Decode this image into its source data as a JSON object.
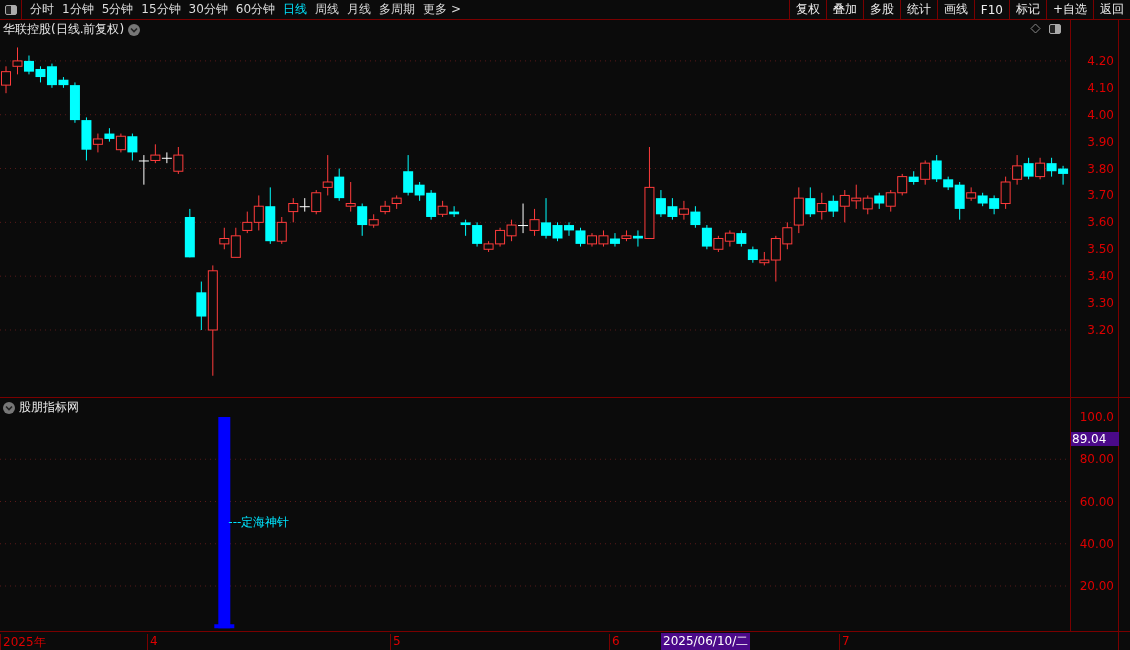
{
  "toolbar": {
    "periods": [
      {
        "label": "分时",
        "selected": false
      },
      {
        "label": "1分钟",
        "selected": false
      },
      {
        "label": "5分钟",
        "selected": false
      },
      {
        "label": "15分钟",
        "selected": false
      },
      {
        "label": "30分钟",
        "selected": false
      },
      {
        "label": "60分钟",
        "selected": false
      },
      {
        "label": "日线",
        "selected": true
      },
      {
        "label": "周线",
        "selected": false
      },
      {
        "label": "月线",
        "selected": false
      },
      {
        "label": "多周期",
        "selected": false
      },
      {
        "label": "更多 >",
        "selected": false
      }
    ],
    "buttons": [
      "复权",
      "叠加",
      "多股",
      "统计",
      "画线",
      "F10",
      "标记",
      "+自选",
      "返回"
    ]
  },
  "price_panel": {
    "title": "华联控股(日线.前复权)",
    "chart_data": {
      "type": "candlestick",
      "grid": true,
      "ylim": [
        2.951,
        4.352
      ],
      "yticks": [
        {
          "value": 4.2,
          "label": "4.20"
        },
        {
          "value": 4.1,
          "label": "4.10"
        },
        {
          "value": 4.0,
          "label": "4.00"
        },
        {
          "value": 3.9,
          "label": "3.90"
        },
        {
          "value": 3.8,
          "label": "3.80"
        },
        {
          "value": 3.7,
          "label": "3.70"
        },
        {
          "value": 3.6,
          "label": "3.60"
        },
        {
          "value": 3.5,
          "label": "3.50"
        },
        {
          "value": 3.4,
          "label": "3.40"
        },
        {
          "value": 3.3,
          "label": "3.30"
        },
        {
          "value": 3.2,
          "label": "3.20"
        }
      ],
      "ohlc": [
        [
          4.11,
          4.18,
          4.08,
          4.16
        ],
        [
          4.18,
          4.25,
          4.15,
          4.2
        ],
        [
          4.2,
          4.22,
          4.15,
          4.16
        ],
        [
          4.17,
          4.18,
          4.12,
          4.14
        ],
        [
          4.18,
          4.19,
          4.1,
          4.11
        ],
        [
          4.13,
          4.14,
          4.1,
          4.11
        ],
        [
          4.11,
          4.12,
          3.97,
          3.98
        ],
        [
          3.98,
          3.99,
          3.83,
          3.87
        ],
        [
          3.89,
          3.93,
          3.86,
          3.91
        ],
        [
          3.93,
          3.95,
          3.9,
          3.91
        ],
        [
          3.87,
          3.93,
          3.86,
          3.92
        ],
        [
          3.92,
          3.93,
          3.83,
          3.86
        ],
        [
          3.83,
          3.85,
          3.74,
          3.83
        ],
        [
          3.83,
          3.89,
          3.82,
          3.85
        ],
        [
          3.84,
          3.86,
          3.82,
          3.84
        ],
        [
          3.79,
          3.88,
          3.78,
          3.85
        ],
        [
          3.62,
          3.65,
          3.47,
          3.47
        ],
        [
          3.34,
          3.38,
          3.2,
          3.25
        ],
        [
          3.2,
          3.44,
          3.03,
          3.42
        ],
        [
          3.52,
          3.58,
          3.5,
          3.54
        ],
        [
          3.47,
          3.58,
          3.47,
          3.55
        ],
        [
          3.57,
          3.64,
          3.56,
          3.6
        ],
        [
          3.6,
          3.7,
          3.57,
          3.66
        ],
        [
          3.66,
          3.73,
          3.52,
          3.53
        ],
        [
          3.53,
          3.62,
          3.52,
          3.6
        ],
        [
          3.64,
          3.69,
          3.6,
          3.67
        ],
        [
          3.66,
          3.69,
          3.64,
          3.66
        ],
        [
          3.64,
          3.72,
          3.63,
          3.71
        ],
        [
          3.73,
          3.85,
          3.7,
          3.75
        ],
        [
          3.77,
          3.8,
          3.68,
          3.69
        ],
        [
          3.66,
          3.75,
          3.64,
          3.67
        ],
        [
          3.66,
          3.67,
          3.55,
          3.59
        ],
        [
          3.59,
          3.63,
          3.58,
          3.61
        ],
        [
          3.64,
          3.68,
          3.63,
          3.66
        ],
        [
          3.67,
          3.7,
          3.65,
          3.69
        ],
        [
          3.79,
          3.85,
          3.7,
          3.71
        ],
        [
          3.74,
          3.75,
          3.68,
          3.7
        ],
        [
          3.71,
          3.72,
          3.61,
          3.62
        ],
        [
          3.63,
          3.68,
          3.62,
          3.66
        ],
        [
          3.64,
          3.66,
          3.62,
          3.63
        ],
        [
          3.6,
          3.61,
          3.55,
          3.59
        ],
        [
          3.59,
          3.6,
          3.51,
          3.52
        ],
        [
          3.5,
          3.53,
          3.49,
          3.52
        ],
        [
          3.52,
          3.58,
          3.51,
          3.57
        ],
        [
          3.55,
          3.61,
          3.53,
          3.59
        ],
        [
          3.59,
          3.67,
          3.56,
          3.59
        ],
        [
          3.57,
          3.65,
          3.55,
          3.61
        ],
        [
          3.6,
          3.69,
          3.54,
          3.55
        ],
        [
          3.59,
          3.6,
          3.53,
          3.54
        ],
        [
          3.59,
          3.6,
          3.55,
          3.57
        ],
        [
          3.57,
          3.58,
          3.51,
          3.52
        ],
        [
          3.52,
          3.56,
          3.51,
          3.55
        ],
        [
          3.52,
          3.57,
          3.51,
          3.55
        ],
        [
          3.54,
          3.56,
          3.51,
          3.52
        ],
        [
          3.54,
          3.57,
          3.53,
          3.55
        ],
        [
          3.55,
          3.57,
          3.51,
          3.54
        ],
        [
          3.54,
          3.88,
          3.54,
          3.73
        ],
        [
          3.69,
          3.72,
          3.62,
          3.63
        ],
        [
          3.66,
          3.69,
          3.61,
          3.62
        ],
        [
          3.63,
          3.68,
          3.61,
          3.65
        ],
        [
          3.64,
          3.66,
          3.58,
          3.59
        ],
        [
          3.58,
          3.59,
          3.5,
          3.51
        ],
        [
          3.5,
          3.55,
          3.49,
          3.54
        ],
        [
          3.53,
          3.57,
          3.51,
          3.56
        ],
        [
          3.56,
          3.57,
          3.51,
          3.52
        ],
        [
          3.5,
          3.51,
          3.45,
          3.46
        ],
        [
          3.45,
          3.49,
          3.44,
          3.46
        ],
        [
          3.46,
          3.55,
          3.38,
          3.54
        ],
        [
          3.52,
          3.6,
          3.5,
          3.58
        ],
        [
          3.59,
          3.73,
          3.56,
          3.69
        ],
        [
          3.69,
          3.73,
          3.62,
          3.63
        ],
        [
          3.64,
          3.71,
          3.61,
          3.67
        ],
        [
          3.68,
          3.7,
          3.62,
          3.64
        ],
        [
          3.66,
          3.72,
          3.6,
          3.7
        ],
        [
          3.68,
          3.74,
          3.65,
          3.69
        ],
        [
          3.65,
          3.7,
          3.63,
          3.69
        ],
        [
          3.7,
          3.71,
          3.65,
          3.67
        ],
        [
          3.66,
          3.72,
          3.64,
          3.71
        ],
        [
          3.71,
          3.78,
          3.7,
          3.77
        ],
        [
          3.77,
          3.79,
          3.74,
          3.75
        ],
        [
          3.76,
          3.83,
          3.74,
          3.82
        ],
        [
          3.83,
          3.85,
          3.75,
          3.76
        ],
        [
          3.76,
          3.77,
          3.72,
          3.73
        ],
        [
          3.74,
          3.75,
          3.61,
          3.65
        ],
        [
          3.69,
          3.73,
          3.68,
          3.71
        ],
        [
          3.7,
          3.71,
          3.66,
          3.67
        ],
        [
          3.69,
          3.7,
          3.63,
          3.65
        ],
        [
          3.67,
          3.77,
          3.65,
          3.75
        ],
        [
          3.76,
          3.85,
          3.74,
          3.81
        ],
        [
          3.82,
          3.84,
          3.76,
          3.77
        ],
        [
          3.77,
          3.84,
          3.76,
          3.82
        ],
        [
          3.82,
          3.84,
          3.77,
          3.79
        ],
        [
          3.8,
          3.81,
          3.74,
          3.78
        ]
      ]
    }
  },
  "indicator_panel": {
    "title": "股朋指标网",
    "chart_data": {
      "type": "bar",
      "grid": true,
      "ylim": [
        -1.3,
        109
      ],
      "yticks": [
        {
          "value": 100,
          "label": "100.0"
        },
        {
          "value": 80,
          "label": "80.00"
        },
        {
          "value": 60,
          "label": "60.00"
        },
        {
          "value": 40,
          "label": "40.00"
        },
        {
          "value": 20,
          "label": "20.00"
        }
      ],
      "series": [
        {
          "color": "#0000ff",
          "values": [
            null,
            null,
            null,
            null,
            null,
            null,
            null,
            null,
            null,
            null,
            null,
            null,
            null,
            null,
            null,
            null,
            null,
            null,
            null,
            100,
            null,
            null,
            null,
            null,
            null,
            null,
            null,
            null,
            null,
            null,
            null,
            null,
            null,
            null,
            null,
            null,
            null,
            null,
            null,
            null,
            null,
            null,
            null,
            null,
            null,
            null,
            null,
            null,
            null,
            null,
            null,
            null,
            null,
            null,
            null,
            null,
            null,
            null,
            null,
            null,
            null,
            null,
            null,
            null,
            null,
            null,
            null,
            null,
            null,
            null,
            null,
            null,
            null,
            null,
            null,
            null,
            null,
            null,
            null,
            null,
            null,
            null,
            null,
            null,
            null,
            null,
            null,
            null,
            null,
            null,
            null,
            null,
            null
          ]
        }
      ],
      "annotations": [
        "---定海神针"
      ]
    },
    "cursor_value": "89.04"
  },
  "date_axis": {
    "labels": [
      "2025年",
      "4",
      "5",
      "6",
      "7"
    ],
    "cursor_date": "2025/06/10/二"
  }
}
